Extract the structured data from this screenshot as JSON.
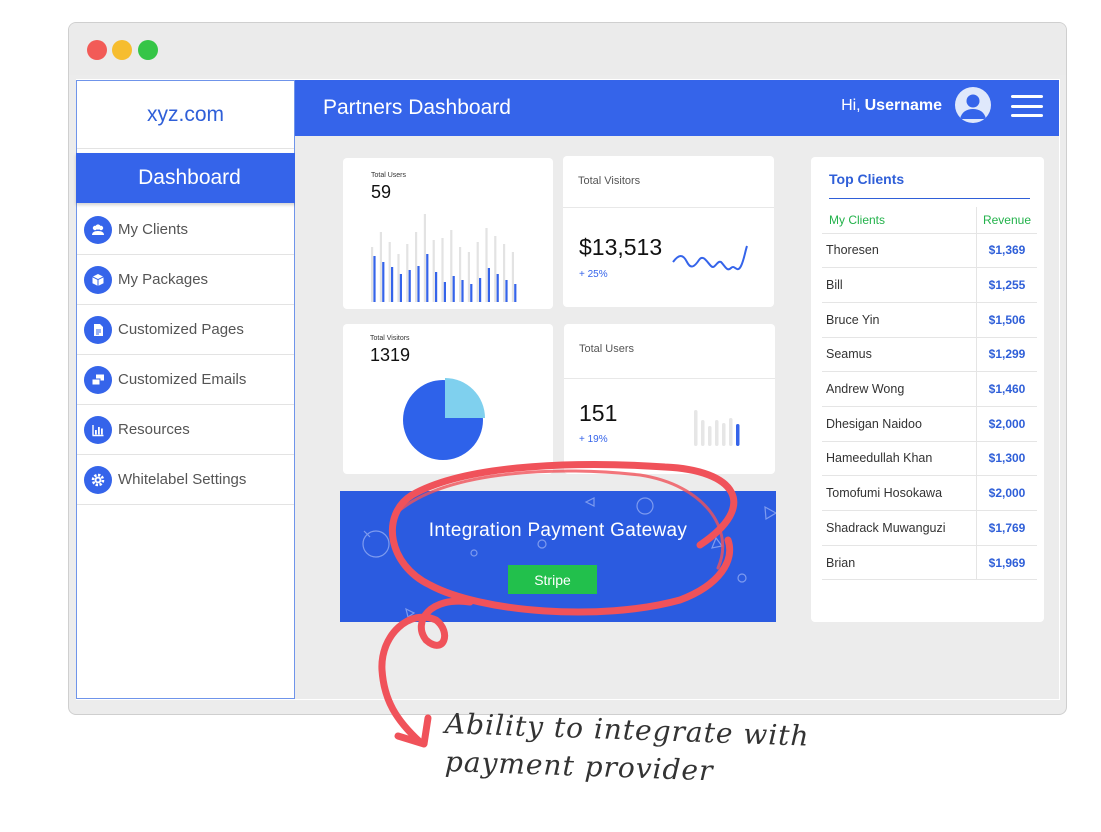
{
  "sidebar": {
    "logo": "xyz.com",
    "active": "Dashboard",
    "items": [
      {
        "label": "My Clients",
        "icon": "users-icon"
      },
      {
        "label": "My Packages",
        "icon": "package-icon"
      },
      {
        "label": "Customized Pages",
        "icon": "page-icon"
      },
      {
        "label": "Customized Emails",
        "icon": "emails-icon"
      },
      {
        "label": "Resources",
        "icon": "chart-icon"
      },
      {
        "label": "Whitelabel Settings",
        "icon": "gear-icon"
      }
    ]
  },
  "header": {
    "title": "Partners Dashboard",
    "greeting": "Hi,",
    "username": "Username"
  },
  "cards": {
    "total_users_title": "Total Users",
    "total_users_value": "59",
    "total_visitors_title": "Total Visitors",
    "total_visitors_value": "$13,513",
    "total_visitors_change": "+ 25%",
    "pie_title": "Total Visitors",
    "pie_value": "1319",
    "users2_title": "Total Users",
    "users2_value": "151",
    "users2_change": "+ 19%"
  },
  "gateway": {
    "title": "Integration Payment  Gateway",
    "button": "Stripe"
  },
  "top_clients": {
    "title": "Top Clients",
    "col_name": "My Clients",
    "col_revenue": "Revenue",
    "rows": [
      {
        "name": "Thoresen",
        "revenue": "$1,369"
      },
      {
        "name": "Bill",
        "revenue": "$1,255"
      },
      {
        "name": "Bruce Yin",
        "revenue": "$1,506"
      },
      {
        "name": "Seamus",
        "revenue": "$1,299"
      },
      {
        "name": "Andrew Wong",
        "revenue": "$1,460"
      },
      {
        "name": "Dhesigan Naidoo",
        "revenue": "$2,000"
      },
      {
        "name": "Hameedullah Khan",
        "revenue": "$1,300"
      },
      {
        "name": "Tomofumi Hosokawa",
        "revenue": "$2,000"
      },
      {
        "name": "Shadrack Muwanguzi",
        "revenue": "$1,769"
      },
      {
        "name": "Brian",
        "revenue": "$1,969"
      }
    ]
  },
  "annotation": {
    "line1": "Ability to integrate with",
    "line2": "payment provider"
  },
  "colors": {
    "primary": "#3564ea",
    "success": "#22c04c",
    "annotation": "#f0525a"
  }
}
